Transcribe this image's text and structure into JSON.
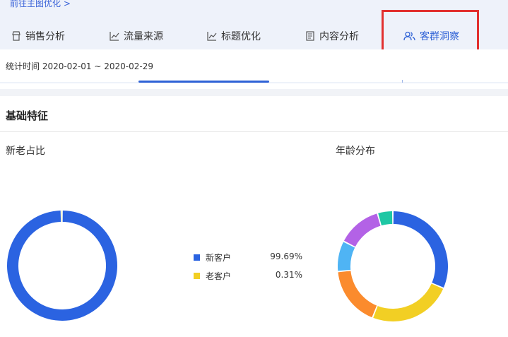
{
  "header": {
    "back_link": "前往主图优化 >",
    "tabs": [
      {
        "label": "销售分析",
        "icon": "shop-icon",
        "active": false
      },
      {
        "label": "流量来源",
        "icon": "line-chart-icon",
        "active": false
      },
      {
        "label": "标题优化",
        "icon": "line-chart-icon",
        "active": false
      },
      {
        "label": "内容分析",
        "icon": "document-icon",
        "active": false
      },
      {
        "label": "客群洞察",
        "icon": "users-icon",
        "active": true
      }
    ],
    "accent_color": "#2f62d6",
    "highlight_color": "#e2302f"
  },
  "filter": {
    "stat_time": "统计时间 2020-02-01 ~ 2020-02-29"
  },
  "section": {
    "title": "基础特征"
  },
  "panels": {
    "new_old": {
      "title": "新老占比",
      "legend": [
        {
          "label": "新客户",
          "value": "99.69%",
          "color": "#2b63e1"
        },
        {
          "label": "老客户",
          "value": "0.31%",
          "color": "#f2cf24"
        }
      ]
    },
    "age": {
      "title": "年龄分布"
    }
  },
  "chart_data": [
    {
      "type": "pie",
      "categories": [
        "新客户",
        "老客户"
      ],
      "values": [
        99.69,
        0.31
      ],
      "colors": [
        "#2b63e1",
        "#f2cf24"
      ]
    },
    {
      "type": "pie",
      "categories": [
        "",
        "",
        "",
        "",
        "",
        ""
      ],
      "values": [
        31.5,
        24.5,
        17.5,
        9,
        13,
        4.5
      ],
      "colors": [
        "#2b63e1",
        "#f2cf24",
        "#fb8b2d",
        "#4fb4f4",
        "#b362e6",
        "#1ec7a4"
      ]
    }
  ]
}
